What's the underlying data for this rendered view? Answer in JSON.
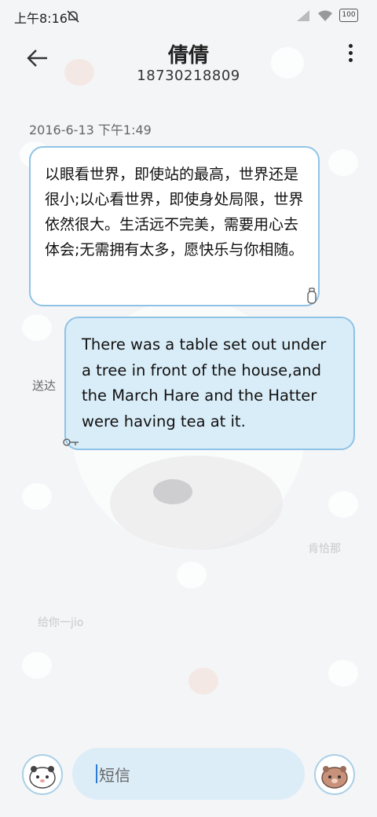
{
  "status_bar": {
    "time": "上午8:16",
    "battery": "100"
  },
  "header": {
    "title": "倩倩",
    "phone": "18730218809"
  },
  "conversation": {
    "timestamp": "2016-6-13 下午1:49",
    "messages": [
      {
        "direction": "incoming",
        "text": "以眼看世界，即使站的最高，世界还是很小;以心看世界，即使身处局限，世界依然很大。生活远不完美，需要用心去体会;无需拥有太多，愿快乐与你相随。"
      },
      {
        "direction": "outgoing",
        "text": "There was a table set out under a tree in front of the house,and the March Hare and the Hatter were having tea at it.",
        "status": "送达"
      }
    ]
  },
  "composer": {
    "placeholder": "短信"
  },
  "wallpaper_texts": {
    "a": "肯恰那",
    "b": "给你一jio"
  },
  "colors": {
    "bubble_border": "#8fc3e6",
    "outgoing_bg": "#d9edf8",
    "input_bg": "#dcedf8"
  },
  "icons": [
    "mute-bell-icon",
    "signal-icon",
    "wifi-icon",
    "battery-icon",
    "back-arrow-icon",
    "more-vert-icon",
    "bottle-icon",
    "key-icon",
    "bear-avatar-icon"
  ]
}
